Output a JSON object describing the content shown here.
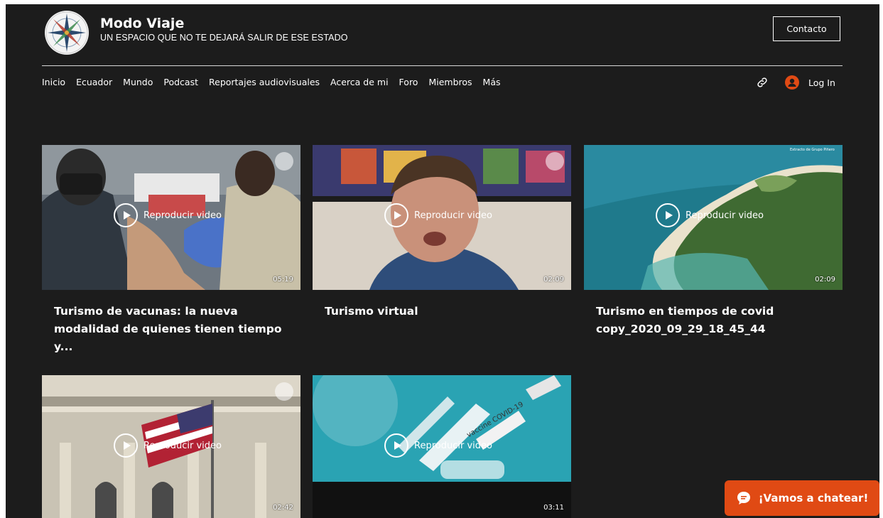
{
  "header": {
    "site_title": "Modo Viaje",
    "site_subtitle": "UN ESPACIO QUE NO TE DEJARÁ SALIR DE ESE ESTADO",
    "contact_label": "Contacto",
    "logo_icon": "compass-rose-icon"
  },
  "nav": {
    "items": [
      "Inicio",
      "Ecuador",
      "Mundo",
      "Podcast",
      "Reportajes audiovisuales",
      "Acerca de mi",
      "Foro",
      "Miembros",
      "Más"
    ],
    "share_icon": "link-icon",
    "avatar_icon": "user-avatar-icon",
    "login_label": "Log In"
  },
  "videos": [
    {
      "title": "Turismo de vacunas: la nueva modalidad de quienes tienen tiempo y...",
      "play_label": "Reproducir video",
      "duration": "05:19"
    },
    {
      "title": "Turismo virtual",
      "play_label": "Reproducir video",
      "duration": "02:09"
    },
    {
      "title": "Turismo en tiempos de covid copy_2020_09_29_18_45_44",
      "play_label": "Reproducir video",
      "duration": "02:09"
    },
    {
      "title": "",
      "play_label": "Reproducir video",
      "duration": "02:42"
    },
    {
      "title": "",
      "play_label": "Reproducir video",
      "duration": "03:11"
    }
  ],
  "thumb_texts": {
    "v3_watermark": "Extracto de Grupo Piñero",
    "v5_vial": "vaccine COVID-19"
  },
  "chat": {
    "label": "¡Vamos a chatear!",
    "icon": "chat-bubble-icon"
  },
  "colors": {
    "background": "#1c1c1c",
    "accent": "#e04a14",
    "text": "#ffffff"
  }
}
